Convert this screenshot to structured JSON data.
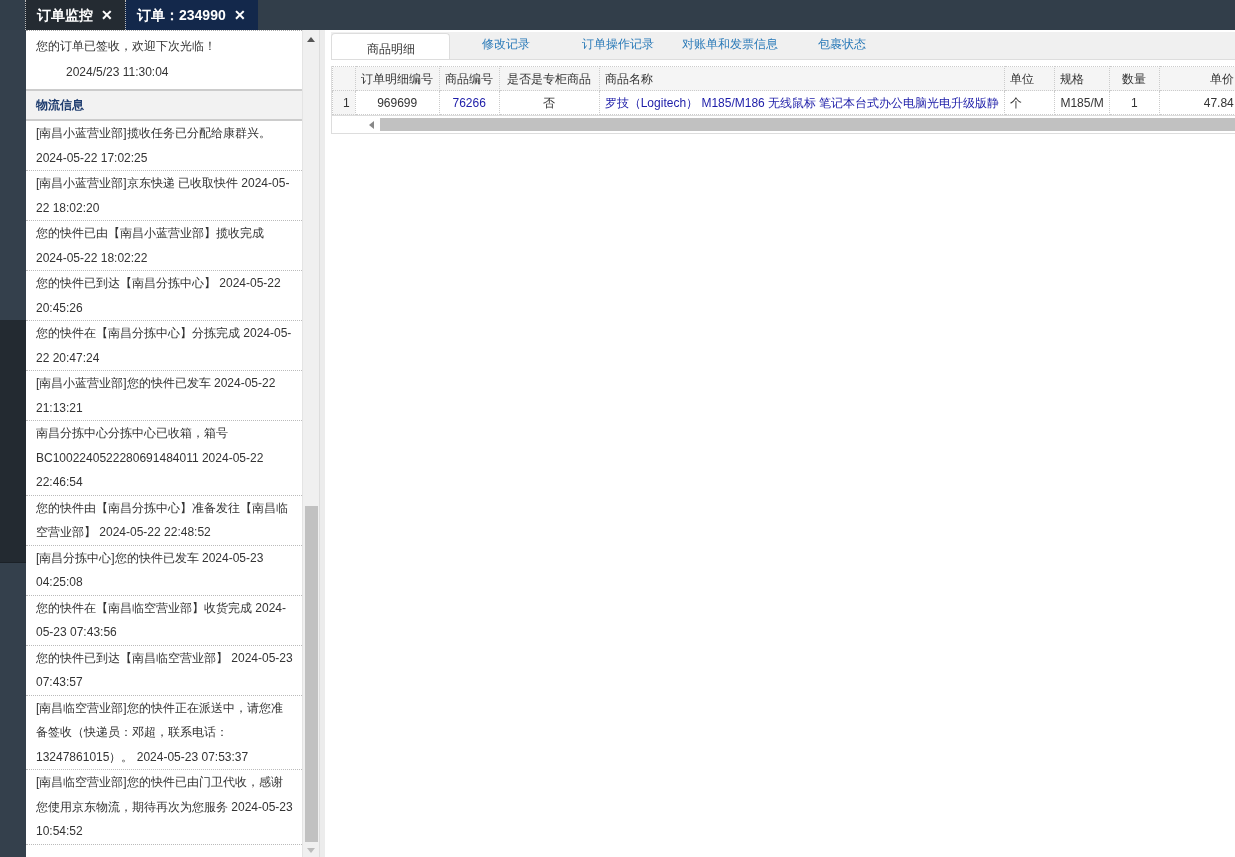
{
  "tabs": [
    {
      "label": "订单监控",
      "close": "✕",
      "selected": false
    },
    {
      "label": "订单：234990",
      "close": "✕",
      "selected": true
    }
  ],
  "order_panel": {
    "notice": {
      "text": "您的订单已签收，欢迎下次光临！",
      "time": "2024/5/23 11:30:04"
    },
    "logistics": {
      "title": "物流信息",
      "entries": [
        "[南昌小蓝营业部]揽收任务已分配给康群兴。 2024-05-22 17:02:25",
        "[南昌小蓝营业部]京东快递 已收取快件 2024-05-22 18:02:20",
        "您的快件已由【南昌小蓝营业部】揽收完成 2024-05-22 18:02:22",
        "您的快件已到达【南昌分拣中心】 2024-05-22 20:45:26",
        "您的快件在【南昌分拣中心】分拣完成 2024-05-22 20:47:24",
        "[南昌小蓝营业部]您的快件已发车 2024-05-22 21:13:21",
        "南昌分拣中心分拣中心已收箱，箱号 BC1002240522280691484011 2024-05-22 22:46:54",
        "您的快件由【南昌分拣中心】准备发往【南昌临空营业部】 2024-05-22 22:48:52",
        "[南昌分拣中心]您的快件已发车 2024-05-23 04:25:08",
        "您的快件在【南昌临空营业部】收货完成 2024-05-23 07:43:56",
        "您的快件已到达【南昌临空营业部】 2024-05-23 07:43:57",
        "[南昌临空营业部]您的快件正在派送中，请您准备签收（快递员：邓超，联系电话：13247861015）。 2024-05-23 07:53:37",
        "[南昌临空营业部]您的快件已由门卫代收，感谢您使用京东物流，期待再次为您服务 2024-05-23 10:54:52"
      ]
    }
  },
  "detail_tabs": [
    {
      "label": "商品明细",
      "selected": true
    },
    {
      "label": "修改记录",
      "selected": false
    },
    {
      "label": "订单操作记录",
      "selected": false
    },
    {
      "label": "对账单和发票信息",
      "selected": false
    },
    {
      "label": "包裹状态",
      "selected": false
    }
  ],
  "table": {
    "columns": [
      "订单明细编号",
      "商品编号",
      "是否是专柜商品",
      "商品名称",
      "单位",
      "规格",
      "数量",
      "单价"
    ],
    "rows": [
      {
        "number": "1",
        "cells": [
          {
            "text": "969699",
            "link": false
          },
          {
            "text": "76266",
            "link": true
          },
          {
            "text": "否",
            "link": false
          },
          {
            "text": "罗技（Logitech） M185/M186 无线鼠标 笔记本台式办公电脑光电升级版静",
            "link": true
          },
          {
            "text": "个",
            "link": false
          },
          {
            "text": "M185/M",
            "link": false
          },
          {
            "text": "1",
            "link": false
          },
          {
            "text": "47.84",
            "link": false
          }
        ]
      }
    ]
  }
}
